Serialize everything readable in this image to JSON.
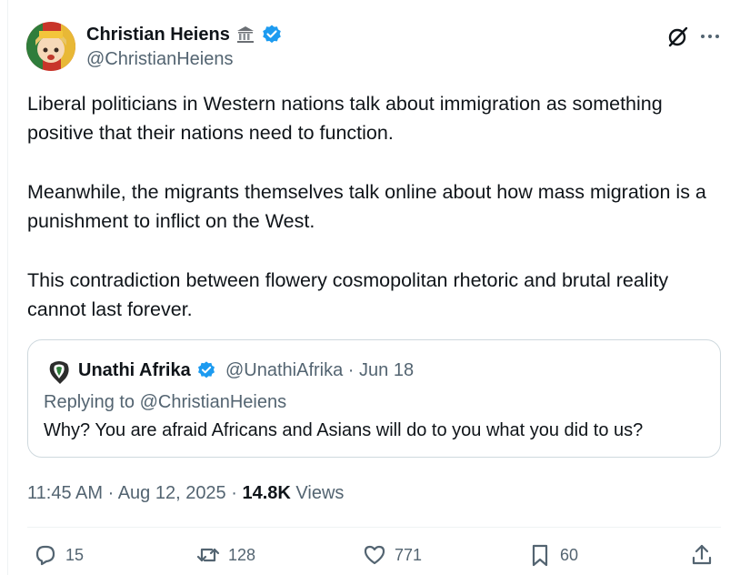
{
  "author": {
    "display_name": "Christian Heiens",
    "handle": "@ChristianHeiens"
  },
  "icons": {
    "affiliation": "classical-building-icon",
    "verified": "verified-badge-icon",
    "grok": "grok-icon",
    "more": "more-icon"
  },
  "tweet": {
    "paragraphs": [
      "Liberal politicians in Western nations talk about immigration as something positive that their nations need to function.",
      "Meanwhile, the migrants themselves talk online about how mass migration is a punishment to inflict on the West.",
      "This contradiction between flowery cosmopolitan rhetoric and brutal reality cannot last forever."
    ]
  },
  "quote": {
    "display_name": "Unathi Afrika",
    "meta": "@UnathiAfrika · Jun 18",
    "replying_to": "Replying to @ChristianHeiens",
    "text": "Why? You are afraid Africans and Asians will do to you what you did to us?"
  },
  "meta": {
    "timestamp": "11:45 AM · Aug 12, 2025 · ",
    "views_count": "14.8K",
    "views_label": " Views"
  },
  "actions": {
    "replies": "15",
    "reposts": "128",
    "likes": "771",
    "bookmarks": "60"
  },
  "colors": {
    "verified": "#1d9bf0",
    "secondary_text": "#536471",
    "border": "#cfd9de"
  }
}
